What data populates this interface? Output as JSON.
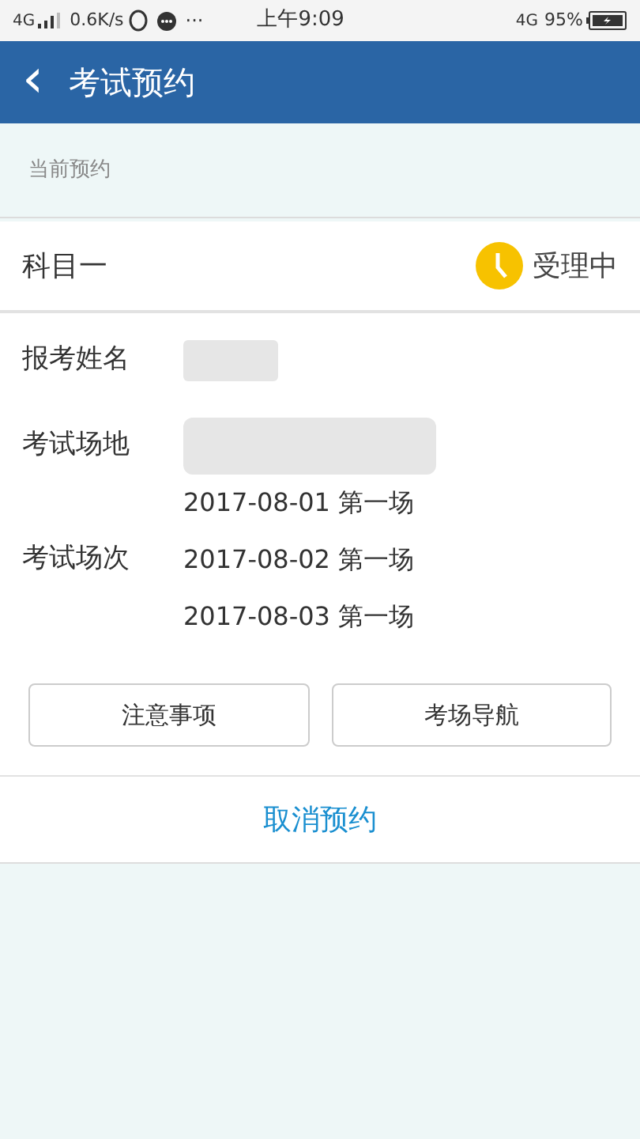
{
  "status_bar": {
    "network": "4G",
    "speed": "0.6K/s",
    "more": "···",
    "time": "上午9:09",
    "network_right": "4G",
    "battery": "95%"
  },
  "header": {
    "back": "‹",
    "title": "考试预约"
  },
  "section_label": "当前预约",
  "appointment": {
    "subject": "科目一",
    "status": "受理中",
    "fields": [
      {
        "label": "报考姓名",
        "kind": "redacted"
      },
      {
        "label": "考试场地",
        "kind": "redacted"
      }
    ],
    "sessions_label": "考试场次",
    "sessions": [
      {
        "date": "2017-08-01",
        "session": "第一场"
      },
      {
        "date": "2017-08-02",
        "session": "第一场"
      },
      {
        "date": "2017-08-03",
        "session": "第一场"
      }
    ],
    "buttons": [
      "注意事项",
      "考场导航"
    ],
    "cancel": "取消预约"
  }
}
